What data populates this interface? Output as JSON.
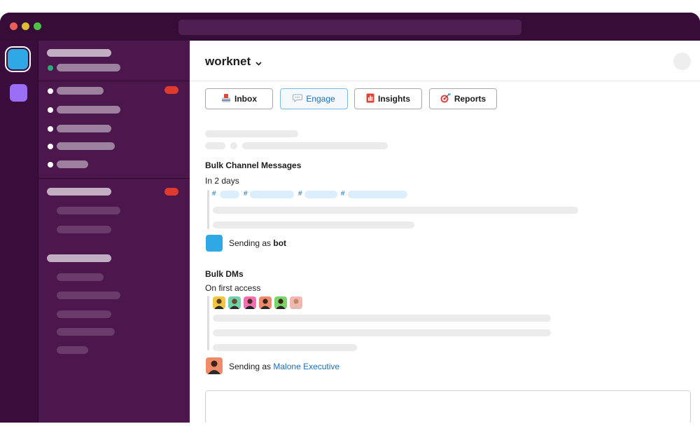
{
  "window": {
    "traffic_lights": [
      "#ec5f57",
      "#e0bb34",
      "#4ec144"
    ]
  },
  "colors": {
    "rail": "#3b0d3c",
    "sidebar": "#4b174c",
    "badge": "#e03a2f",
    "link": "#1a6fb8",
    "presence": "#2bac76"
  },
  "workspace": {
    "name": "worknet",
    "dropdown_icon": "chevron-down-icon"
  },
  "tabs": [
    {
      "label": "Inbox",
      "icon": "inbox-icon",
      "active": false
    },
    {
      "label": "Engage",
      "icon": "speech-bubble-icon",
      "active": true
    },
    {
      "label": "Insights",
      "icon": "chart-icon",
      "active": false
    },
    {
      "label": "Reports",
      "icon": "target-icon",
      "active": false
    }
  ],
  "bulk_channel": {
    "heading": "Bulk Channel Messages",
    "schedule": "In 2 days",
    "channel_prefix": "#",
    "sender_prefix": "Sending as ",
    "sender_name": "bot"
  },
  "bulk_dms": {
    "heading": "Bulk DMs",
    "schedule": "On first access",
    "recipient_avatar_colors": [
      "#f0c840",
      "#6dd3a8",
      "#f06fb0",
      "#f08a6a",
      "#7bd46a",
      "#f2b7b0"
    ],
    "sender_prefix": "Sending as ",
    "sender_name": "Malone Executive"
  }
}
